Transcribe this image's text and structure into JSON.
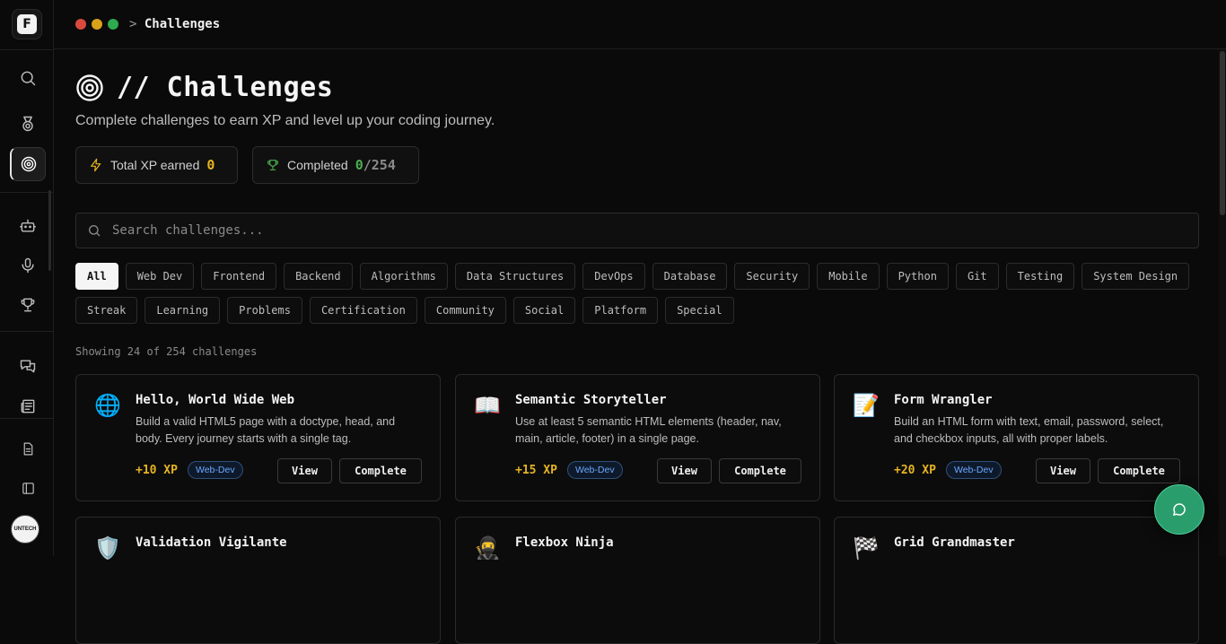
{
  "breadcrumb": {
    "sep": ">",
    "current": "Challenges"
  },
  "page": {
    "title": "// Challenges",
    "subtitle": "Complete challenges to earn XP and level up your coding journey."
  },
  "stats": {
    "xp_label": "Total XP earned",
    "xp_value": "0",
    "completed_label": "Completed",
    "completed_value": "0",
    "completed_total": "/254"
  },
  "search": {
    "placeholder": "Search challenges..."
  },
  "filters": {
    "row1": [
      "All",
      "Web Dev",
      "Frontend",
      "Backend",
      "Algorithms",
      "Data Structures",
      "DevOps",
      "Database",
      "Security",
      "Mobile",
      "Python",
      "Git",
      "Testing",
      "System Design"
    ],
    "row2": [
      "Streak",
      "Learning",
      "Problems",
      "Certification",
      "Community",
      "Social",
      "Platform",
      "Special"
    ],
    "active": "All"
  },
  "showing": "Showing 24 of 254 challenges",
  "cards": [
    {
      "icon": "🌐",
      "title": "Hello, World Wide Web",
      "desc": "Build a valid HTML5 page with a doctype, head, and body. Every journey starts with a single tag.",
      "xp": "+10 XP",
      "tag": "Web-Dev",
      "view": "View",
      "complete": "Complete"
    },
    {
      "icon": "📖",
      "title": "Semantic Storyteller",
      "desc": "Use at least 5 semantic HTML elements (header, nav, main, article, footer) in a single page.",
      "xp": "+15 XP",
      "tag": "Web-Dev",
      "view": "View",
      "complete": "Complete"
    },
    {
      "icon": "📝",
      "title": "Form Wrangler",
      "desc": "Build an HTML form with text, email, password, select, and checkbox inputs, all with proper labels.",
      "xp": "+20 XP",
      "tag": "Web-Dev",
      "view": "View",
      "complete": "Complete"
    },
    {
      "icon": "🛡️",
      "title": "Validation Vigilante"
    },
    {
      "icon": "🥷",
      "title": "Flexbox Ninja"
    },
    {
      "icon": "🏁",
      "title": "Grid Grandmaster"
    }
  ],
  "avatar": {
    "text": "UNTECH"
  },
  "colors": {
    "accent_green": "#2a9d6c",
    "xp_gold": "#e6b422",
    "tag_blue": "#6aa7ff",
    "completed_green": "#4caf50"
  }
}
